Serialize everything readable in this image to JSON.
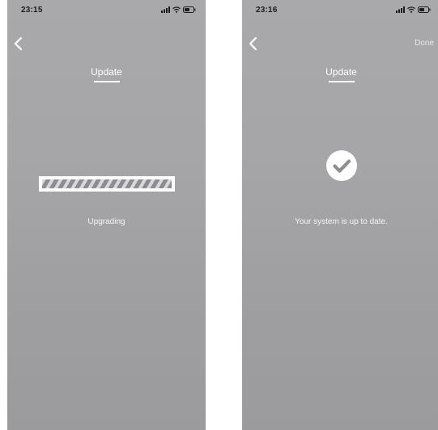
{
  "screens": [
    {
      "status_time": "23:15",
      "title": "Update",
      "message": "Upgrading",
      "progress_percent": 100
    },
    {
      "status_time": "23:16",
      "title": "Update",
      "done_label": "Done",
      "message": "Your system is up to date."
    }
  ],
  "icons": {
    "back": "chevron-left-icon",
    "signal": "cellular-signal-icon",
    "wifi": "wifi-icon",
    "battery": "battery-icon",
    "success": "checkmark-circle-icon"
  },
  "colors": {
    "screen_background": "#a7a7a9",
    "foreground": "#ffffff",
    "status_text": "#1c1c1e",
    "progress_stripe_dark": "#8d8d90",
    "progress_stripe_light": "#d8d8da"
  }
}
